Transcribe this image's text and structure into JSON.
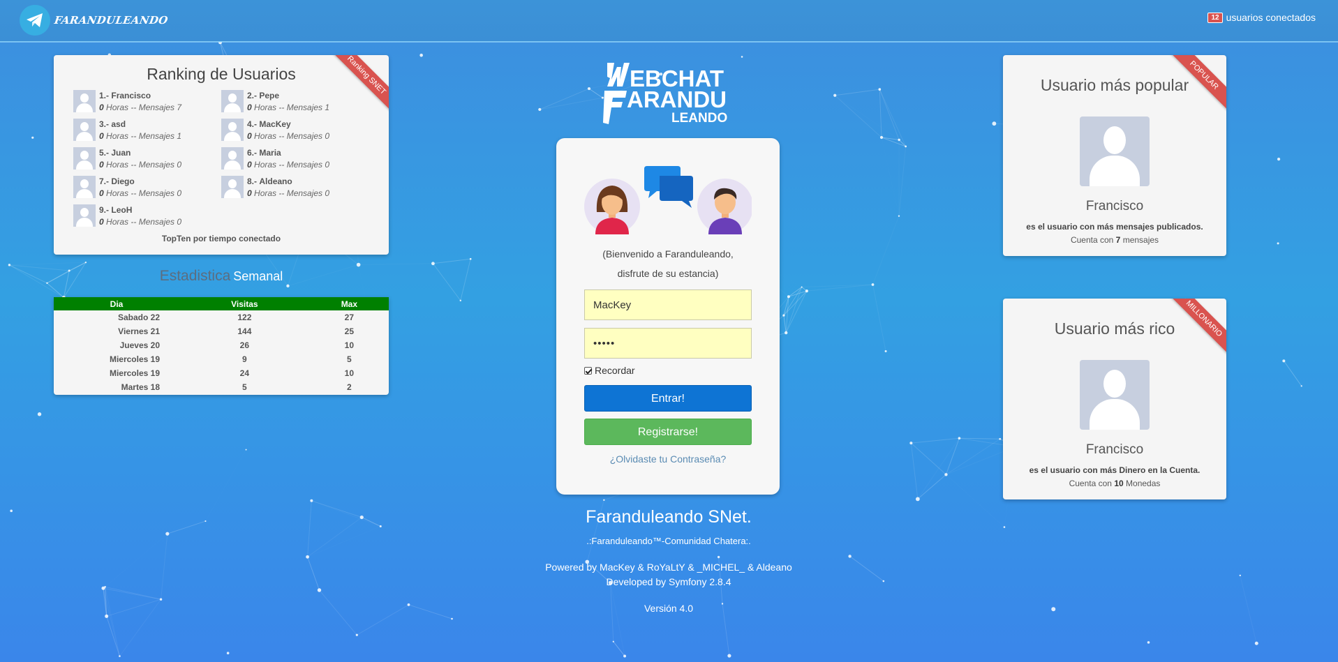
{
  "header": {
    "brand": "FARANDULEANDO",
    "online_count": "12",
    "online_label": "usuarios conectados"
  },
  "ranking": {
    "title": "Ranking de Usuarios",
    "ribbon": "Ranking SNET",
    "hours_label": "Horas -- Mensajes",
    "items": [
      {
        "pos": "1.-",
        "name": "Francisco",
        "hours": "0",
        "stats": "Horas -- Mensajes 7"
      },
      {
        "pos": "2.-",
        "name": "Pepe",
        "hours": "0",
        "stats": "Horas -- Mensajes 1"
      },
      {
        "pos": "3.-",
        "name": "asd",
        "hours": "0",
        "stats": "Horas -- Mensajes 1"
      },
      {
        "pos": "4.-",
        "name": "MacKey",
        "hours": "0",
        "stats": "Horas -- Mensajes 0"
      },
      {
        "pos": "5.-",
        "name": "Juan",
        "hours": "0",
        "stats": "Horas -- Mensajes 0"
      },
      {
        "pos": "6.-",
        "name": "Maria",
        "hours": "0",
        "stats": "Horas -- Mensajes 0"
      },
      {
        "pos": "7.-",
        "name": "Diego",
        "hours": "0",
        "stats": "Horas -- Mensajes 0"
      },
      {
        "pos": "8.-",
        "name": "Aldeano",
        "hours": "0",
        "stats": "Horas -- Mensajes 0"
      },
      {
        "pos": "9.-",
        "name": "LeoH",
        "hours": "0",
        "stats": "Horas -- Mensajes 0"
      }
    ],
    "footer": "TopTen por tiempo conectado"
  },
  "stats": {
    "title_a": "Estadistica",
    "title_b": "Semanal",
    "headers": [
      "Dia",
      "Visitas",
      "Max"
    ],
    "rows": [
      [
        "Sabado 22",
        "122",
        "27"
      ],
      [
        "Viernes 21",
        "144",
        "25"
      ],
      [
        "Jueves 20",
        "26",
        "10"
      ],
      [
        "Miercoles 19",
        "9",
        "5"
      ],
      [
        "Miercoles 19",
        "24",
        "10"
      ],
      [
        "Martes 18",
        "5",
        "2"
      ]
    ]
  },
  "logo": {
    "line1": "EBCHAT",
    "line2": "ARANDU",
    "line3": "LEANDO"
  },
  "login": {
    "welcome_1": "(Bienvenido a Faranduleando,",
    "welcome_2": "disfrute de su estancia)",
    "username": "MacKey",
    "password": "•••••",
    "remember": "Recordar",
    "submit": "Entrar!",
    "register": "Registrarse!",
    "forgot": "¿Olvidaste tu Contraseña?"
  },
  "footer": {
    "brand": "Faranduleando SNet.",
    "tagline": ".:Faranduleando™-Comunidad Chatera:.",
    "powered": "Powered by MacKey & RoYaLtY & _MICHEL_ & Aldeano",
    "developed": "Developed by Symfony 2.8.4",
    "version": "Versión 4.0"
  },
  "popular": {
    "ribbon": "POPULAR",
    "title": "Usuario más popular",
    "name": "Francisco",
    "desc": "es el usuario con más mensajes publicados.",
    "count_pre": "Cuenta con",
    "count": "7",
    "count_post": "mensajes"
  },
  "rich": {
    "ribbon": "MILLONARIO",
    "title": "Usuario más rico",
    "name": "Francisco",
    "desc": "es el usuario con más Dinero en la Cuenta.",
    "count_pre": "Cuenta con",
    "count": "10",
    "count_post": "Monedas"
  },
  "colors": {
    "background": "#3a96e4",
    "ribbon": "#d9534f",
    "table_header": "#008000",
    "btn_login": "#0e74d4",
    "btn_register": "#5cb85c",
    "input_bg": "#ffffc1"
  }
}
